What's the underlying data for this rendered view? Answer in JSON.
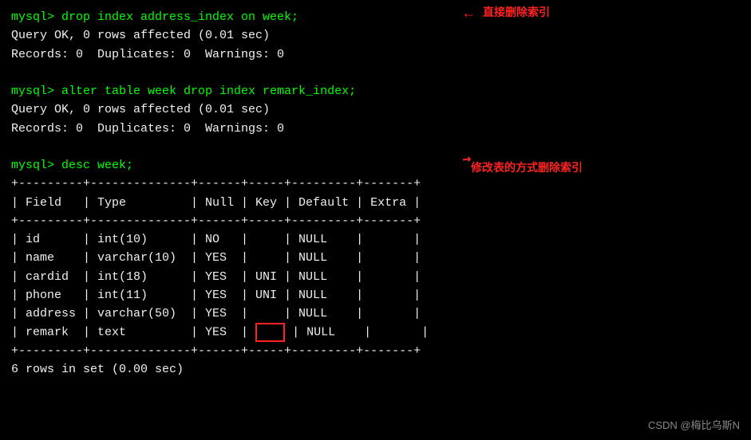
{
  "terminal": {
    "lines": [
      {
        "id": "cmd1",
        "text": "mysql> drop index address_index on week;",
        "color": "green"
      },
      {
        "id": "result1",
        "text": "Query OK, 0 rows affected (0.01 sec)",
        "color": "white"
      },
      {
        "id": "result2",
        "text": "Records: 0  Duplicates: 0  Warnings: 0",
        "color": "white"
      },
      {
        "id": "blank1",
        "text": "",
        "color": "white"
      },
      {
        "id": "cmd2",
        "text": "mysql> alter table week drop index remark_index;",
        "color": "green"
      },
      {
        "id": "result3",
        "text": "Query OK, 0 rows affected (0.01 sec)",
        "color": "white"
      },
      {
        "id": "result4",
        "text": "Records: 0  Duplicates: 0  Warnings: 0",
        "color": "white"
      },
      {
        "id": "blank2",
        "text": "",
        "color": "white"
      },
      {
        "id": "cmd3",
        "text": "mysql> desc week;",
        "color": "green"
      },
      {
        "id": "sep1",
        "text": "+---------+--------------+------+-----+---------+-------+",
        "color": "white"
      },
      {
        "id": "header",
        "text": "| Field   | Type         | Null | Key | Default | Extra |",
        "color": "white"
      },
      {
        "id": "sep2",
        "text": "+---------+--------------+------+-----+---------+-------+",
        "color": "white"
      },
      {
        "id": "row1",
        "text": "| id      | int(10)      | NO   |     | NULL    |       |",
        "color": "white"
      },
      {
        "id": "row2",
        "text": "| name    | varchar(10)  | YES  |     | NULL    |       |",
        "color": "white"
      },
      {
        "id": "row3",
        "text": "| cardid  | int(18)      | YES  | UNI | NULL    |       |",
        "color": "white"
      },
      {
        "id": "row4",
        "text": "| phone   | int(11)      | YES  | UNI | NULL    |       |",
        "color": "white"
      },
      {
        "id": "row5",
        "text": "| address | varchar(50)  | YES  |     | NULL    |       |",
        "color": "white"
      },
      {
        "id": "row6_prefix",
        "text": "| remark  | text         | YES  |",
        "color": "white"
      },
      {
        "id": "row6_suffix",
        "text": "| NULL    |       |",
        "color": "white"
      },
      {
        "id": "sep3",
        "text": "+---------+--------------+------+-----+---------+-------+",
        "color": "white"
      },
      {
        "id": "footer",
        "text": "6 rows in set (0.00 sec)",
        "color": "white"
      }
    ],
    "annotations": {
      "direct_delete": "直接删除索引",
      "alter_delete": "修改表的方式删除索引"
    },
    "watermark": "CSDN @梅比乌斯N"
  }
}
